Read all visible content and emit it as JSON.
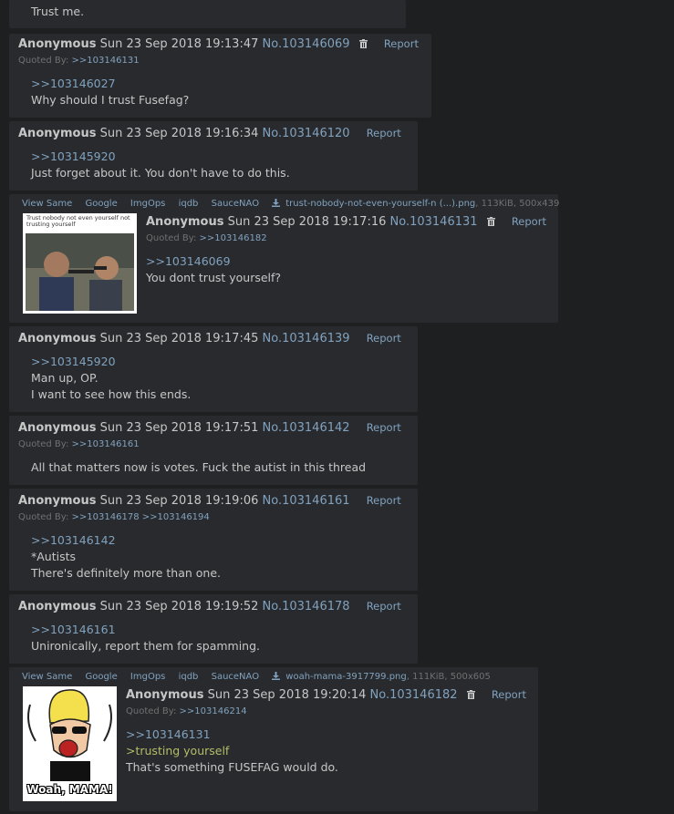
{
  "actions": {
    "report": "Report"
  },
  "top_post": {
    "text": "Trust me."
  },
  "file_tools": [
    "View Same",
    "Google",
    "ImgOps",
    "iqdb",
    "SauceNAO"
  ],
  "posts": [
    {
      "name": "Anonymous",
      "date": "Sun 23 Sep 2018 19:13:47",
      "no": "No.103146069",
      "quoted_label": "Quoted By:",
      "quoted_by": ">>103146131",
      "lines": [
        {
          "t": "quote",
          "text": ">>103146027"
        },
        {
          "t": "text",
          "text": "Why should I trust Fusefag?"
        }
      ]
    },
    {
      "name": "Anonymous",
      "date": "Sun 23 Sep 2018 19:16:34",
      "no": "No.103146120",
      "lines": [
        {
          "t": "quote",
          "text": ">>103145920"
        },
        {
          "t": "text",
          "text": "Just forget about it. You don't have to do this."
        }
      ]
    },
    {
      "name": "Anonymous",
      "date": "Sun 23 Sep 2018 19:17:16",
      "no": "No.103146131",
      "quoted_label": "Quoted By:",
      "quoted_by": ">>103146182",
      "file_name": "trust-nobody-not-even-yourself-n (...).png",
      "file_meta": ", 113KiB, 500x439",
      "thumb_caption": "Trust nobody not even yourself not trusting yourself",
      "lines": [
        {
          "t": "quote",
          "text": ">>103146069"
        },
        {
          "t": "text",
          "text": "You dont trust yourself?"
        }
      ]
    },
    {
      "name": "Anonymous",
      "date": "Sun 23 Sep 2018 19:17:45",
      "no": "No.103146139",
      "lines": [
        {
          "t": "quote",
          "text": ">>103145920"
        },
        {
          "t": "text",
          "text": "Man up, OP."
        },
        {
          "t": "text",
          "text": "I want to see how this ends."
        }
      ]
    },
    {
      "name": "Anonymous",
      "date": "Sun 23 Sep 2018 19:17:51",
      "no": "No.103146142",
      "quoted_label": "Quoted By:",
      "quoted_by": ">>103146161",
      "lines": [
        {
          "t": "text",
          "text": "All that matters now is votes. Fuck the autist in this thread"
        }
      ]
    },
    {
      "name": "Anonymous",
      "date": "Sun 23 Sep 2018 19:19:06",
      "no": "No.103146161",
      "quoted_label": "Quoted By:",
      "quoted_by": ">>103146178 >>103146194",
      "lines": [
        {
          "t": "quote",
          "text": ">>103146142"
        },
        {
          "t": "text",
          "text": "*Autists"
        },
        {
          "t": "text",
          "text": "There's definitely more than one."
        }
      ]
    },
    {
      "name": "Anonymous",
      "date": "Sun 23 Sep 2018 19:19:52",
      "no": "No.103146178",
      "lines": [
        {
          "t": "quote",
          "text": ">>103146161"
        },
        {
          "t": "text",
          "text": "Unironically, report them for spamming."
        }
      ]
    },
    {
      "name": "Anonymous",
      "date": "Sun 23 Sep 2018 19:20:14",
      "no": "No.103146182",
      "quoted_label": "Quoted By:",
      "quoted_by": ">>103146214",
      "file_name": "woah-mama-3917799.png",
      "file_meta": ", 111KiB, 500x605",
      "thumb_caption": "Woah, MAMA!",
      "lines": [
        {
          "t": "quote",
          "text": ">>103146131"
        },
        {
          "t": "green",
          "text": ">trusting yourself"
        },
        {
          "t": "text",
          "text": "That's something FUSEFAG would do."
        }
      ]
    }
  ]
}
